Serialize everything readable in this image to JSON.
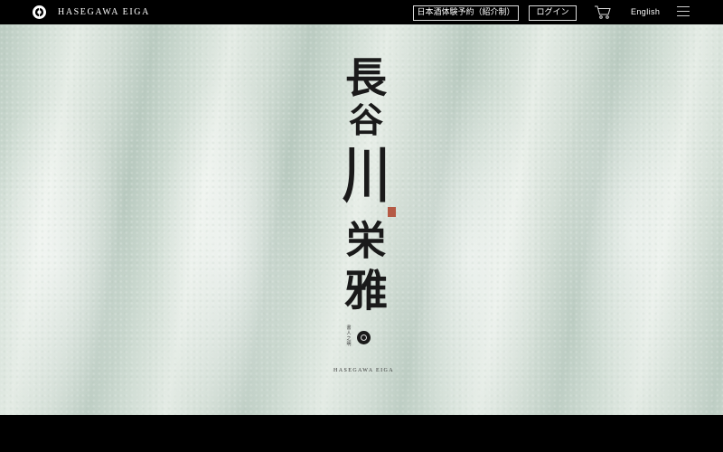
{
  "header": {
    "brand_name": "HASEGAWA EIGA",
    "reserve_button": "日本酒体験予約（紹介制）",
    "login_button": "ログイン",
    "language_link": "English"
  },
  "hero": {
    "title_chars": [
      "長",
      "谷",
      "川",
      "栄",
      "雅"
    ],
    "small_vertical_text": "書 人 之 明",
    "subtitle": "HASEGAWA EIGA"
  },
  "colors": {
    "bar_background": "#000000",
    "hero_tint": "#d2ddd5",
    "seal_red": "#b55a45"
  }
}
